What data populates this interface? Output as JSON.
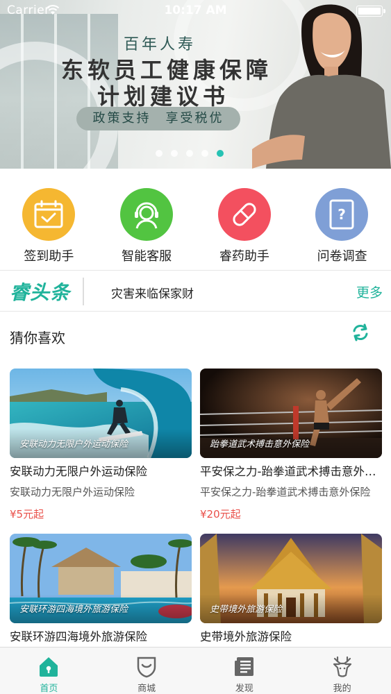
{
  "status_bar": {
    "carrier": "Carrier",
    "time": "10:17 AM"
  },
  "banner": {
    "brand": "百年人寿",
    "title_line1": "东软员工健康保障",
    "title_line2": "计划建议书",
    "pill": "政策支持　享受税优",
    "slide_count": 5,
    "active_slide": 5
  },
  "quick_actions": [
    {
      "label": "签到助手",
      "icon": "calendar-check-icon",
      "color": "#f5b731"
    },
    {
      "label": "智能客服",
      "icon": "headset-agent-icon",
      "color": "#52c441"
    },
    {
      "label": "睿药助手",
      "icon": "pill-icon",
      "color": "#f3505f"
    },
    {
      "label": "问卷调查",
      "icon": "questionnaire-icon",
      "color": "#7f9fd6"
    }
  ],
  "news": {
    "logo": "睿头条",
    "headline": "灾害来临保家财",
    "more": "更多"
  },
  "recommend": {
    "title": "猜你喜欢",
    "items": [
      {
        "caption": "安联动力无限户外运动保险",
        "name": "安联动力无限户外运动保险",
        "desc": "安联动力无限户外运动保险",
        "price": "¥5元起"
      },
      {
        "caption": "跆拳道武术搏击意外保险",
        "name": "平安保之力-跆拳道武术搏击意外保险",
        "desc": "平安保之力-跆拳道武术搏击意外保险",
        "price": "¥20元起"
      },
      {
        "caption": "安联环游四海境外旅游保险",
        "name": "安联环游四海境外旅游保险"
      },
      {
        "caption": "史带境外旅游保险",
        "name": "史带境外旅游保险"
      }
    ]
  },
  "tabbar": [
    {
      "label": "首页",
      "icon": "home-icon",
      "active": true
    },
    {
      "label": "商城",
      "icon": "shield-icon",
      "active": false
    },
    {
      "label": "发现",
      "icon": "document-list-icon",
      "active": false
    },
    {
      "label": "我的",
      "icon": "deer-icon",
      "active": false
    }
  ],
  "colors": {
    "accent": "#20b39b",
    "price": "#e9504a"
  }
}
